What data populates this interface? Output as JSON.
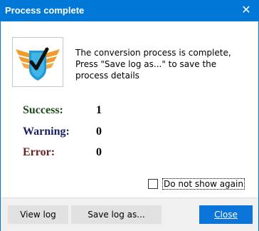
{
  "window": {
    "title": "Process complete",
    "close_glyph": "✕",
    "title_bar_color": "#0078d7"
  },
  "icon": {
    "name": "checkmark-shield-wings-icon",
    "accent": "#f39a2c",
    "shield": "#1e9bd7"
  },
  "message": {
    "line1": "The conversion process is complete,",
    "line2": "Press \"Save log as...\" to save the process details"
  },
  "stats": {
    "success": {
      "label": "Success:",
      "value": "1",
      "color": "#1c4a1c"
    },
    "warning": {
      "label": "Warning:",
      "value": "0",
      "color": "#1c1f63"
    },
    "error": {
      "label": "Error:",
      "value": "0",
      "color": "#6b1f1f"
    }
  },
  "checkbox": {
    "label": "Do not show again",
    "checked": false
  },
  "buttons": {
    "view_log": "View log",
    "save_log": "Save log as...",
    "close": "Close",
    "close_color": "#0a74d8"
  }
}
